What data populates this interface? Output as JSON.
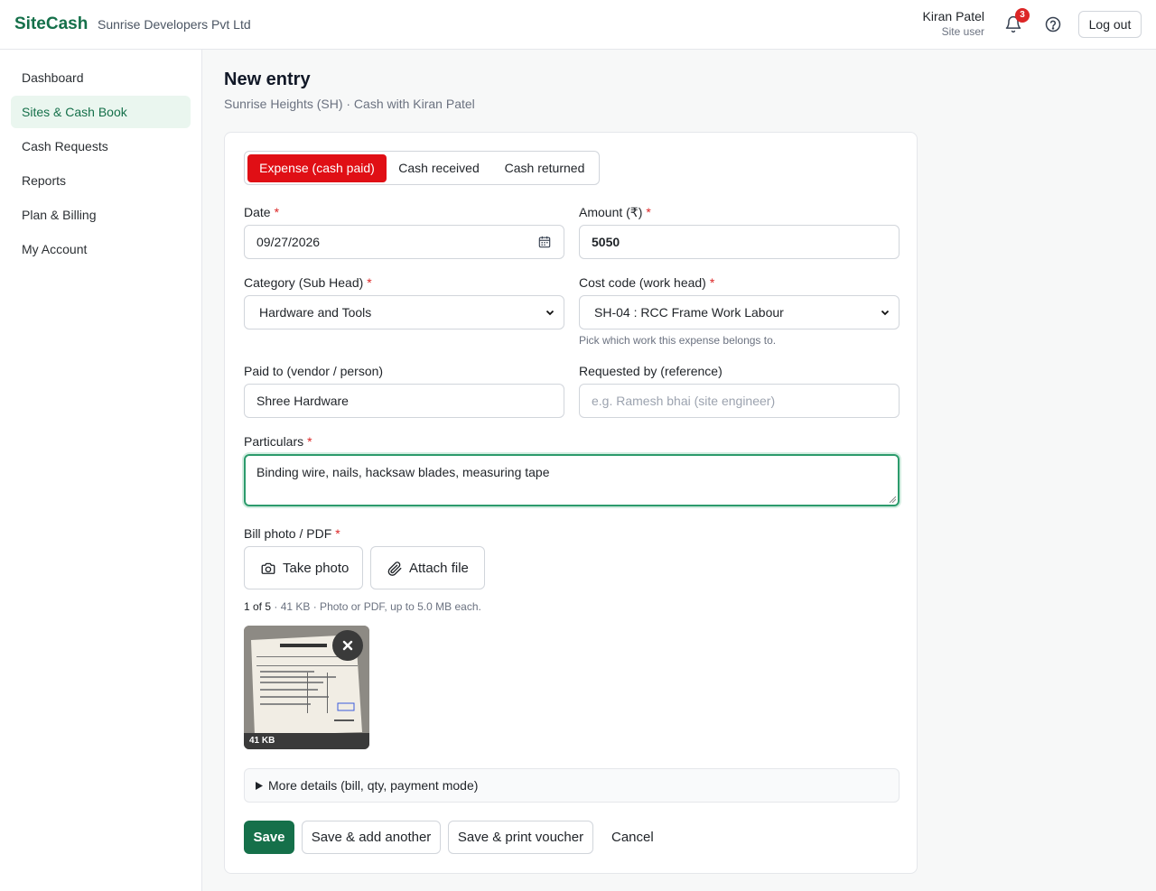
{
  "header": {
    "brand": "SiteCash",
    "company": "Sunrise Developers Pvt Ltd",
    "user_name": "Kiran Patel",
    "user_role": "Site user",
    "notification_count": "3",
    "logout_label": "Log out"
  },
  "sidebar": {
    "items": [
      {
        "label": "Dashboard",
        "active": false
      },
      {
        "label": "Sites & Cash Book",
        "active": true
      },
      {
        "label": "Cash Requests",
        "active": false
      },
      {
        "label": "Reports",
        "active": false
      },
      {
        "label": "Plan & Billing",
        "active": false
      },
      {
        "label": "My Account",
        "active": false
      }
    ]
  },
  "page": {
    "title": "New entry",
    "subtitle": "Sunrise Heights (SH) · Cash with Kiran Patel"
  },
  "entry_type": {
    "options": [
      "Expense (cash paid)",
      "Cash received",
      "Cash returned"
    ],
    "selected": "Expense (cash paid)"
  },
  "form": {
    "date": {
      "label": "Date",
      "value": "09/27/2026"
    },
    "amount": {
      "label": "Amount (₹)",
      "value": "5050"
    },
    "category": {
      "label": "Category (Sub Head)",
      "value": "Hardware and Tools"
    },
    "cost_code": {
      "label": "Cost code (work head)",
      "value": "SH-04 : RCC Frame Work Labour",
      "hint": "Pick which work this expense belongs to."
    },
    "paid_to": {
      "label": "Paid to (vendor / person)",
      "value": "Shree Hardware"
    },
    "requested_by": {
      "label": "Requested by (reference)",
      "placeholder": "e.g. Ramesh bhai (site engineer)"
    },
    "particulars": {
      "label": "Particulars",
      "value": "Binding wire, nails, hacksaw blades, measuring tape"
    },
    "bill": {
      "label": "Bill photo / PDF",
      "take_photo": "Take photo",
      "attach_file": "Attach file",
      "count": "1 of 5",
      "meta": "· 41 KB · Photo or PDF, up to 5.0 MB each.",
      "thumb_size": "41 KB"
    },
    "more_details": "More details (bill, qty, payment mode)"
  },
  "actions": {
    "save": "Save",
    "save_add": "Save & add another",
    "save_print": "Save & print voucher",
    "cancel": "Cancel"
  },
  "colors": {
    "brand_green": "#15704a",
    "expense_red": "#e00f15",
    "badge_red": "#dc2626"
  }
}
